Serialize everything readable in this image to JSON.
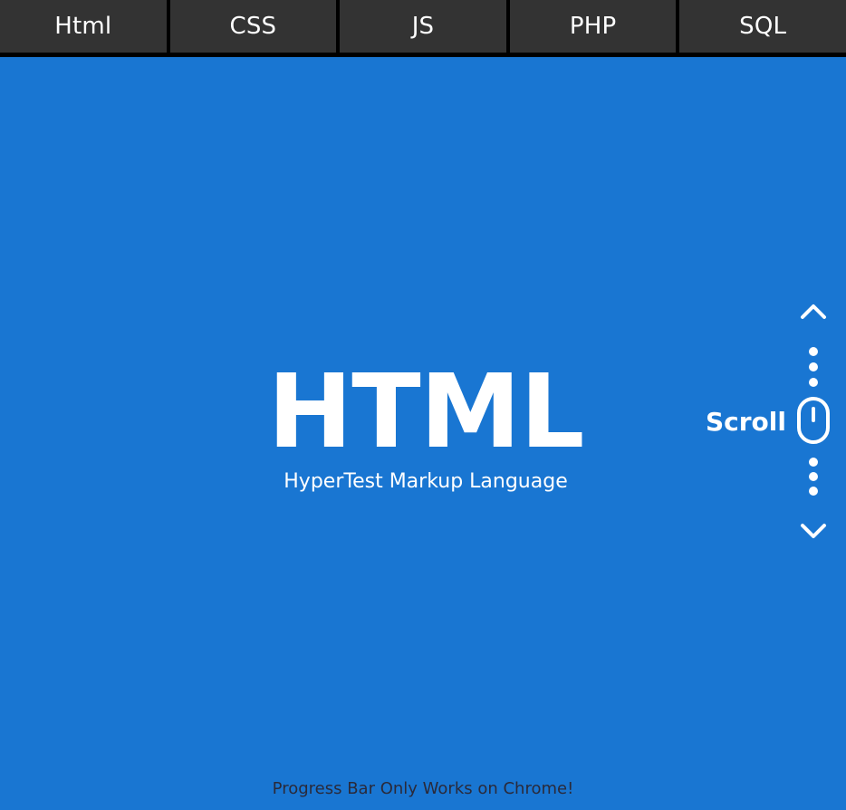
{
  "nav": {
    "tabs": [
      {
        "label": "Html"
      },
      {
        "label": "CSS"
      },
      {
        "label": "JS"
      },
      {
        "label": "PHP"
      },
      {
        "label": "SQL"
      }
    ]
  },
  "hero": {
    "title": "HTML",
    "subtitle": "HyperTest Markup Language"
  },
  "scroll": {
    "label": "Scroll",
    "icons": [
      "chevron-up-icon",
      "dots-icon",
      "mouse-icon",
      "dots-icon",
      "chevron-down-icon"
    ]
  },
  "footer": {
    "note": "Progress Bar Only Works on Chrome!"
  },
  "colors": {
    "background": "#1976d2",
    "nav_background": "#000000",
    "tab_background": "#333333",
    "text": "#ffffff",
    "footer_text": "#2a2a3a"
  }
}
